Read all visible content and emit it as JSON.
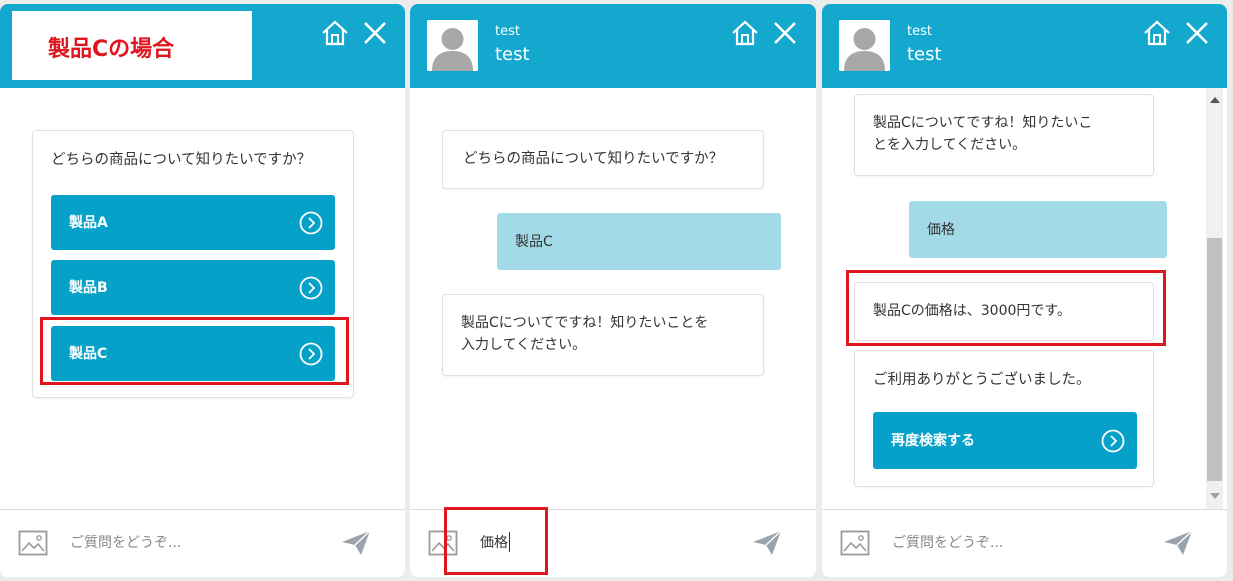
{
  "colors": {
    "header": "#14a8cf",
    "button": "#06a1c8",
    "user_bubble": "#a2dae7",
    "highlight": "#e0161f"
  },
  "panel1": {
    "title_label": "製品Cの場合",
    "question": "どちらの商品について知りたいですか？",
    "options": [
      {
        "label": "製品A"
      },
      {
        "label": "製品B"
      },
      {
        "label": "製品C"
      }
    ],
    "input_placeholder": "ご質問をどうぞ..."
  },
  "panel2": {
    "bot_name_small": "test",
    "bot_name": "test",
    "messages": [
      {
        "from": "bot",
        "text": "どちらの商品について知りたいですか？"
      },
      {
        "from": "user",
        "text": "製品C"
      },
      {
        "from": "bot",
        "text_line1": "製品Cについてですね！知りたいことを",
        "text_line2": "入力してください。"
      }
    ],
    "input_value": "価格"
  },
  "panel3": {
    "bot_name_small": "test",
    "bot_name": "test",
    "messages": [
      {
        "from": "bot",
        "text_line1": "製品Cについてですね！知りたいこ",
        "text_line2": "とを入力してください。"
      },
      {
        "from": "user",
        "text": "価格"
      },
      {
        "from": "bot",
        "text": "製品Cの価格は、3000円です。"
      },
      {
        "from": "bot",
        "text": "ご利用ありがとうございました。",
        "button": "再度検索する"
      }
    ],
    "input_placeholder": "ご質問をどうぞ..."
  },
  "icons": [
    "home-icon",
    "close-icon",
    "chevron-right-circle-icon",
    "image-icon",
    "send-icon",
    "avatar-icon"
  ]
}
